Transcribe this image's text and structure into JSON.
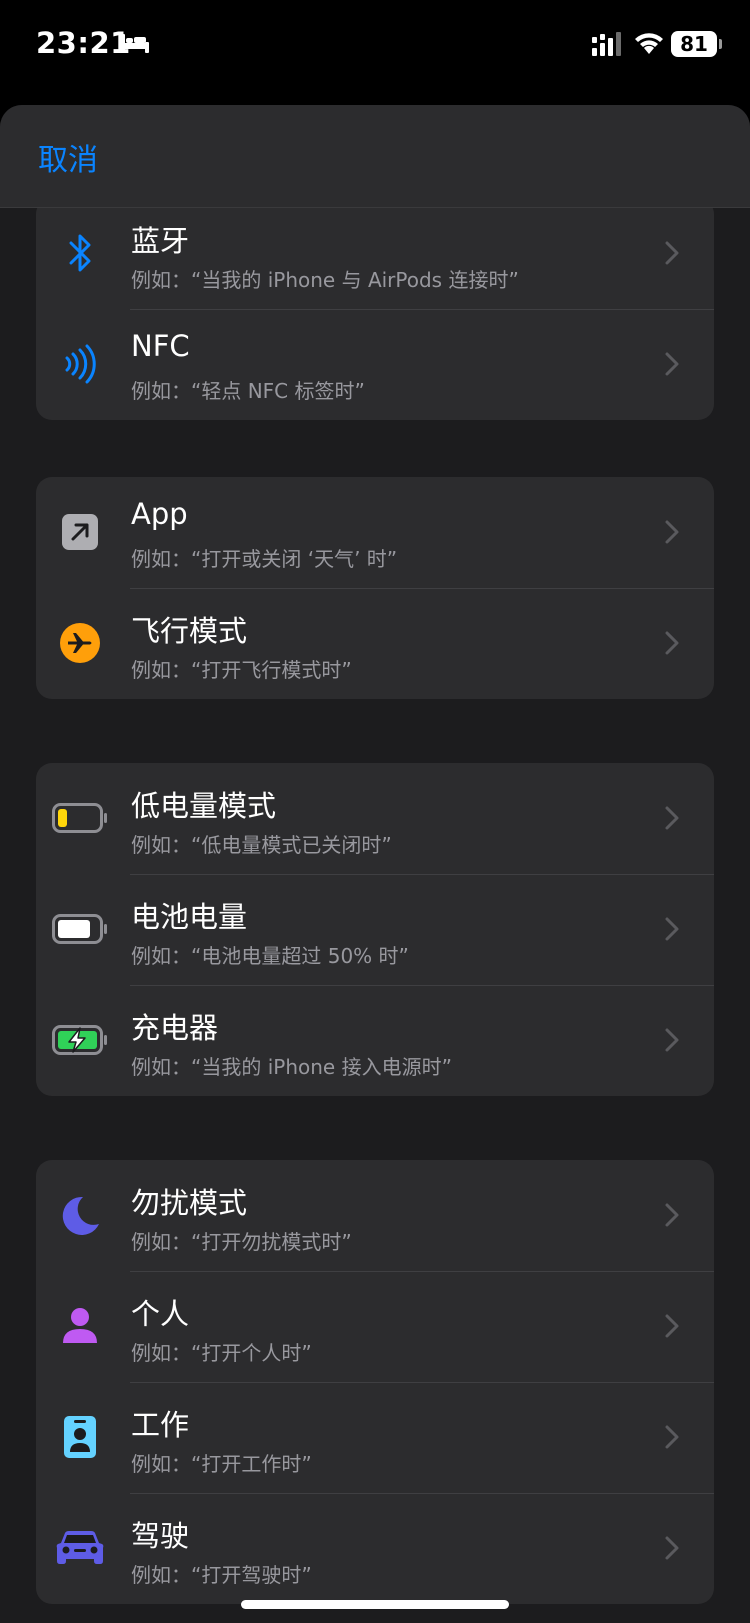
{
  "status_bar": {
    "time": "23:21",
    "battery_level": "81",
    "icons": [
      "bed-icon",
      "cellular-signal-icon",
      "wifi-icon",
      "battery-icon"
    ]
  },
  "nav": {
    "cancel_label": "取消"
  },
  "colors": {
    "accent": "#0a84ff",
    "bluetooth": "#0a84ff",
    "nfc": "#0a84ff",
    "airplane": "#ff9f0a",
    "low_power": "#ffd60a",
    "charger": "#30d158",
    "focus_moon": "#5e5ce6",
    "personal": "#bf5af2",
    "work": "#64d2ff",
    "driving": "#5e5ce6"
  },
  "groups": [
    {
      "items": [
        {
          "title": "蓝牙",
          "subtitle": "例如：“当我的 iPhone 与 AirPods 连接时”",
          "icon": "bluetooth-icon"
        },
        {
          "title": "NFC",
          "subtitle": "例如：“轻点 NFC 标签时”",
          "icon": "nfc-icon"
        }
      ]
    },
    {
      "items": [
        {
          "title": "App",
          "subtitle": "例如：“打开或关闭 ‘天气’ 时”",
          "icon": "app-arrow-icon"
        },
        {
          "title": "飞行模式",
          "subtitle": "例如：“打开飞行模式时”",
          "icon": "airplane-icon"
        }
      ]
    },
    {
      "items": [
        {
          "title": "低电量模式",
          "subtitle": "例如：“低电量模式已关闭时”",
          "icon": "low-battery-icon"
        },
        {
          "title": "电池电量",
          "subtitle": "例如：“电池电量超过 50% 时”",
          "icon": "battery-level-icon"
        },
        {
          "title": "充电器",
          "subtitle": "例如：“当我的 iPhone 接入电源时”",
          "icon": "charging-battery-icon"
        }
      ]
    },
    {
      "items": [
        {
          "title": "勿扰模式",
          "subtitle": "例如：“打开勿扰模式时”",
          "icon": "moon-icon"
        },
        {
          "title": "个人",
          "subtitle": "例如：“打开个人时”",
          "icon": "person-icon"
        },
        {
          "title": "工作",
          "subtitle": "例如：“打开工作时”",
          "icon": "badge-icon"
        },
        {
          "title": "驾驶",
          "subtitle": "例如：“打开驾驶时”",
          "icon": "car-icon"
        }
      ]
    }
  ]
}
